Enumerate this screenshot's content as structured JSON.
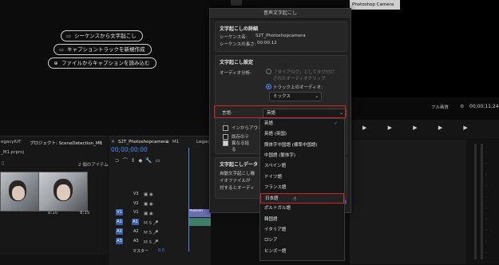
{
  "colors": {
    "accent": "#3c5fa8",
    "highlight": "#d2232a",
    "check": "#4a8bf5"
  },
  "source": {
    "buttons": [
      {
        "icon": "caption-icon",
        "label": "シーケンスから文字起こし"
      },
      {
        "icon": "caption-icon",
        "label": "キャプショントラックを新規作成"
      },
      {
        "icon": "plus-icon",
        "label": "ファイルからキャプションを読み込む"
      }
    ]
  },
  "project": {
    "tab_lut": "egacyIUT",
    "tab_project": "プロジェクト: SceneDetection_M1",
    "file": "_M1.prproj",
    "items_count": "2 個のアイテム",
    "thumb1_dur": "8;10",
    "thumb2_dur": "8;15"
  },
  "timeline": {
    "tab_seq": "S2T_Photoshopcamera",
    "tab_m1": "M1",
    "tab_legacy": "Legacy",
    "timecode": "00;00;00;00",
    "tracks": [
      "V3",
      "V2",
      "V1",
      "A1",
      "A2",
      "A3"
    ],
    "master_label": "マスター",
    "master_value": "0.0",
    "clip_label": "Photosh"
  },
  "program": {
    "fit_label": "フル画質",
    "timecode": "00;00;11;24",
    "title_bar": "Photoshop Camera"
  },
  "dialog": {
    "title": "音声文字起こし",
    "sec1_title": "文字起こしの詳細",
    "seq_name_label": "シーケンス名:",
    "seq_name_value": "S2T_Photoshopcamera",
    "seq_len_label": "シーケンスの長さ:",
    "seq_len_value": "00:00:12",
    "sec2_title": "文字起こし設定",
    "audio_label": "オーディオ分析:",
    "radio1": "「ダイアログ」としてタグ付け",
    "radio1b": "されたオーディオクリップ",
    "radio2": "トラック上のオーディオ:",
    "track_select": "ミックス",
    "lang_label": "言語:",
    "lang_value": "英語",
    "check1": "インからアウト",
    "check2a": "既存のテ",
    "check2b": "異なる話",
    "check2c": "る",
    "sec3_title": "文字起こしデータ",
    "sec3_line1": "自動文字起こし機",
    "sec3_line2": "イオファイルが",
    "sec3_line3": "対するとオーディ"
  },
  "languages": [
    {
      "label": "英語",
      "checked": true
    },
    {
      "label": "英語 (英国)",
      "checked": false
    },
    {
      "label": "簡体字中国語 (標準中国語)",
      "checked": false
    },
    {
      "label": "中国語 (繁体字)",
      "checked": false
    },
    {
      "label": "スペイン語",
      "checked": false
    },
    {
      "label": "ドイツ語",
      "checked": false
    },
    {
      "label": "フランス語",
      "checked": false
    },
    {
      "label": "日本語",
      "checked": false
    },
    {
      "label": "ポルトガル語",
      "checked": false
    },
    {
      "label": "韓国語",
      "checked": false
    },
    {
      "label": "イタリア語",
      "checked": false
    },
    {
      "label": "ロシア",
      "checked": false
    },
    {
      "label": "ヒンズー語",
      "checked": false
    }
  ]
}
